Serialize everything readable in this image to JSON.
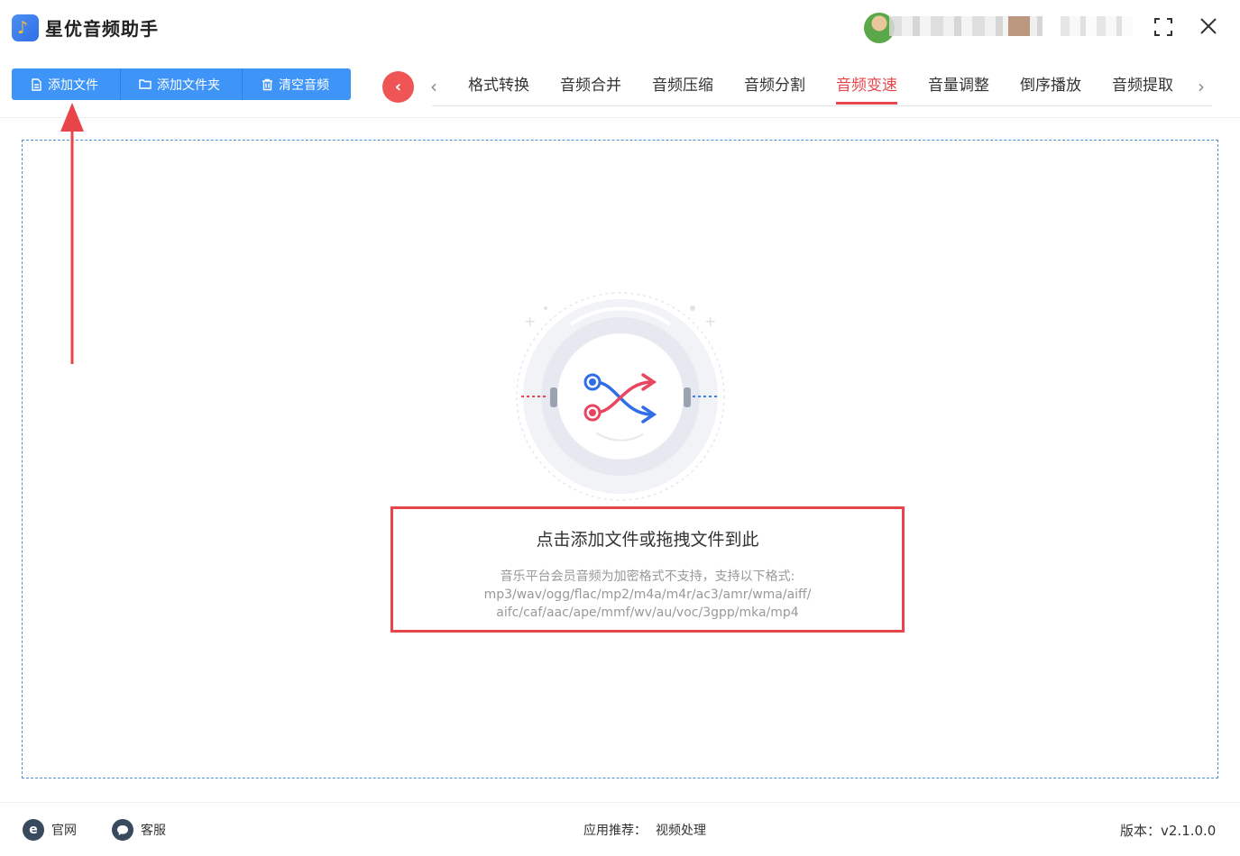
{
  "app": {
    "title": "星优音频助手"
  },
  "toolbar": {
    "add_file": "添加文件",
    "add_folder": "添加文件夹",
    "clear_audio": "清空音频"
  },
  "tabs": [
    {
      "label": "格式转换"
    },
    {
      "label": "音频合并"
    },
    {
      "label": "音频压缩"
    },
    {
      "label": "音频分割"
    },
    {
      "label": "音频变速",
      "active": true
    },
    {
      "label": "音量调整"
    },
    {
      "label": "倒序播放"
    },
    {
      "label": "音频提取"
    }
  ],
  "dropzone": {
    "title": "点击添加文件或拖拽文件到此",
    "desc_line1": "音乐平台会员音频为加密格式不支持，支持以下格式:",
    "desc_line2": "mp3/wav/ogg/flac/mp2/m4a/m4r/ac3/amr/wma/aiff/",
    "desc_line3": "aifc/caf/aac/ape/mmf/wv/au/voc/3gpp/mka/mp4"
  },
  "footer": {
    "website": "官网",
    "service": "客服",
    "recommend_label": "应用推荐：",
    "recommend_value": "视频处理",
    "version": "版本：v2.1.0.0"
  },
  "colors": {
    "primary": "#3f95f7",
    "accent_red": "#e5474c",
    "annotation_red": "#e8454b",
    "dropzone_border": "#4a90d9"
  },
  "icons": {
    "app": "music-note-icon",
    "window_maximize": "maximize-icon",
    "window_close": "close-icon",
    "back": "chevron-left-icon",
    "tab_prev": "chevron-left-icon",
    "tab_next": "chevron-right-icon",
    "website": "ie-globe-icon",
    "service": "chat-bubble-icon"
  }
}
